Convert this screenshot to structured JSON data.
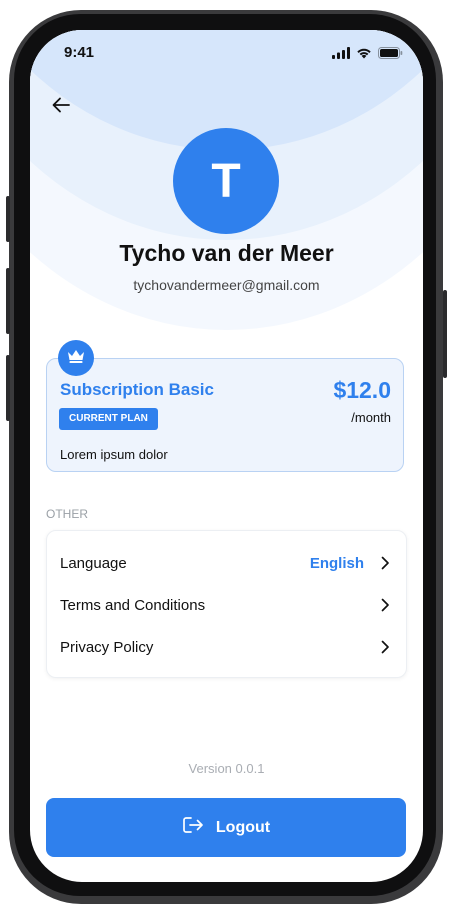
{
  "status_bar": {
    "time": "9:41"
  },
  "profile": {
    "avatar_initial": "T",
    "name": "Tycho van der Meer",
    "email": "tychovandermeer@gmail.com"
  },
  "subscription": {
    "title": "Subscription Basic",
    "badge": "CURRENT PLAN",
    "price": "$12.0",
    "period": "/month",
    "description": "Lorem ipsum dolor"
  },
  "other_section": {
    "label": "OTHER",
    "items": [
      {
        "label": "Language",
        "value": "English"
      },
      {
        "label": "Terms and Conditions"
      },
      {
        "label": "Privacy Policy"
      }
    ]
  },
  "footer": {
    "version": "Version 0.0.1",
    "logout_label": "Logout"
  },
  "colors": {
    "accent": "#2f80ed",
    "background_band": "#d6e6fb"
  },
  "icons": [
    "back-arrow-icon",
    "signal-icon",
    "wifi-icon",
    "battery-icon",
    "crown-icon",
    "chevron-right-icon",
    "logout-icon"
  ]
}
